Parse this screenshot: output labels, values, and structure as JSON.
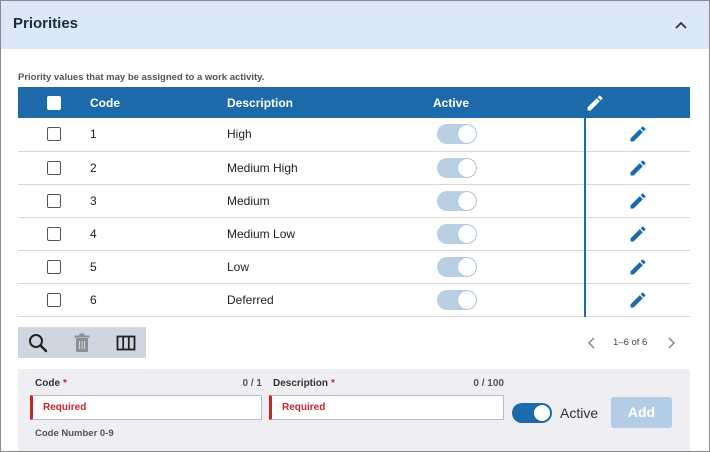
{
  "panel": {
    "title": "Priorities",
    "collapse_icon": "chevron-up-icon"
  },
  "caption": "Priority values that may be assigned to a work activity.",
  "table": {
    "columns": {
      "code": "Code",
      "description": "Description",
      "active": "Active",
      "edit_icon": "pencil-icon"
    },
    "rows": [
      {
        "code": "1",
        "description": "High",
        "active": true
      },
      {
        "code": "2",
        "description": "Medium High",
        "active": true
      },
      {
        "code": "3",
        "description": "Medium",
        "active": true
      },
      {
        "code": "4",
        "description": "Medium Low",
        "active": true
      },
      {
        "code": "5",
        "description": "Low",
        "active": true
      },
      {
        "code": "6",
        "description": "Deferred",
        "active": true
      }
    ]
  },
  "toolbar": {
    "search_icon": "search-icon",
    "delete_icon": "trash-icon",
    "columns_icon": "columns-icon"
  },
  "pager": {
    "label": "1–6 of 6",
    "prev_icon": "chevron-left-icon",
    "next_icon": "chevron-right-icon"
  },
  "form": {
    "code": {
      "label": "Code",
      "required_mark": "*",
      "count": "0 / 1",
      "placeholder": "Required",
      "hint": "Code Number 0-9"
    },
    "description": {
      "label": "Description",
      "required_mark": "*",
      "count": "0 / 100",
      "placeholder": "Required"
    },
    "active": {
      "label": "Active",
      "value": true
    },
    "add_label": "Add"
  },
  "colors": {
    "header_bg": "#dce8f7",
    "accent": "#1d6aab",
    "required": "#c4262e",
    "toggle_disabled": "#b9cfe4",
    "add_disabled": "#b3cde6"
  }
}
